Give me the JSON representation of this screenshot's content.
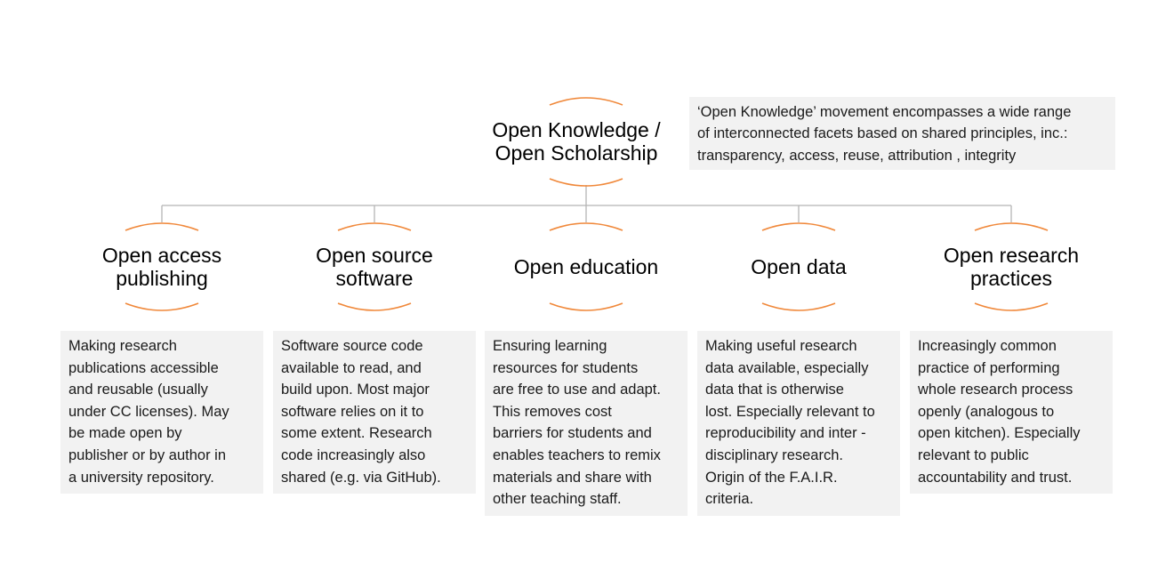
{
  "root": {
    "title_lines": [
      "Open Knowledge /",
      "Open Scholarship"
    ],
    "description_lines": [
      "‘Open Knowledge’ movement encompasses a wide range",
      "of interconnected facets based on shared principles, inc.:",
      "transparency, access, reuse, attribution  , integrity"
    ]
  },
  "colors": {
    "accent": "#f0883a",
    "connector": "#b5b5b5",
    "panel": "#f2f2f2"
  },
  "facets": [
    {
      "title_lines": [
        "Open access",
        "publishing"
      ],
      "description_lines": [
        "Making research",
        "publications accessible",
        "and reusable (usually",
        "under CC licenses). May",
        "be made open by",
        "publisher or by author in",
        "a university repository."
      ]
    },
    {
      "title_lines": [
        "Open source",
        "software"
      ],
      "description_lines": [
        "Software source code",
        "available to read, and",
        "build upon.  Most major",
        "software relies on it to",
        "some extent. Research",
        "code increasingly also",
        "shared (e.g. via GitHub)."
      ]
    },
    {
      "title_lines": [
        "Open education"
      ],
      "description_lines": [
        "Ensuring learning",
        "resources for students",
        "are free to use and adapt.",
        "This removes cost",
        "barriers for students and",
        "enables teachers to remix",
        "materials and share with",
        "other  teaching staff."
      ]
    },
    {
      "title_lines": [
        "Open data"
      ],
      "description_lines": [
        "Making useful research",
        "data available, especially",
        "data that is otherwise",
        "lost. Especially relevant to",
        "reproducibility and inter  -",
        "disciplinary research.",
        "Origin of the F.A.I.R.",
        "criteria."
      ]
    },
    {
      "title_lines": [
        "Open research",
        "practices"
      ],
      "description_lines": [
        "Increasingly common",
        "practice of performing",
        "whole research process",
        "openly (analogous to",
        "open kitchen). Especially",
        "relevant to public",
        "accountability and trust."
      ]
    }
  ]
}
